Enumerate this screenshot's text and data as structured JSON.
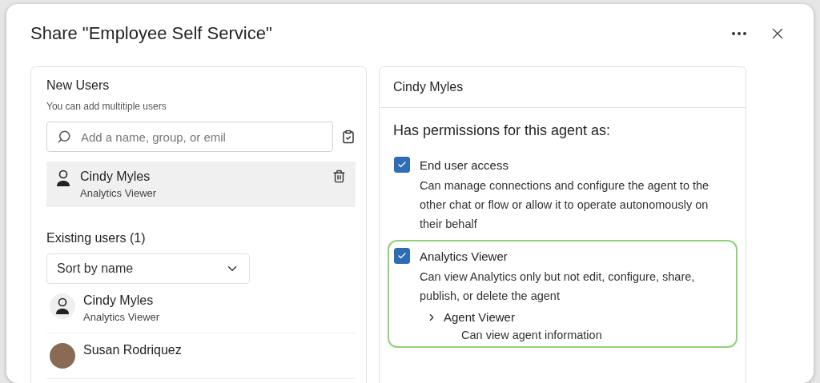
{
  "dialog": {
    "title": "Share \"Employee Self Service\""
  },
  "new_users": {
    "heading": "New Users",
    "hint": "You can add multitiple users",
    "search": {
      "placeholder": "Add a name, group, or emil"
    },
    "added": [
      {
        "name": "Cindy Myles",
        "role": "Analytics Viewer",
        "selected": true
      }
    ]
  },
  "existing_users": {
    "heading": "Existing users (1)",
    "sort": {
      "value": "Sort by name"
    },
    "users": [
      {
        "name": "Cindy Myles",
        "role": "Analytics Viewer",
        "kind": "icon"
      },
      {
        "name": "Susan Rodriquez",
        "kind": "photo"
      }
    ]
  },
  "detail": {
    "user": "Cindy Myles",
    "heading": "Has permissions for this agent as:",
    "permissions": [
      {
        "label": "End user access",
        "description": "Can manage connections and configure the agent to the other chat or flow or allow it to operate autonomously on their behalf",
        "checked": true,
        "highlighted": false
      },
      {
        "label": "Analytics Viewer",
        "description": "Can view Analytics only but not edit, configure, share, publish, or delete the agent",
        "checked": true,
        "highlighted": true,
        "children": [
          {
            "label": "Agent Viewer",
            "description": "Can view agent information",
            "expanded": false
          }
        ]
      }
    ]
  }
}
